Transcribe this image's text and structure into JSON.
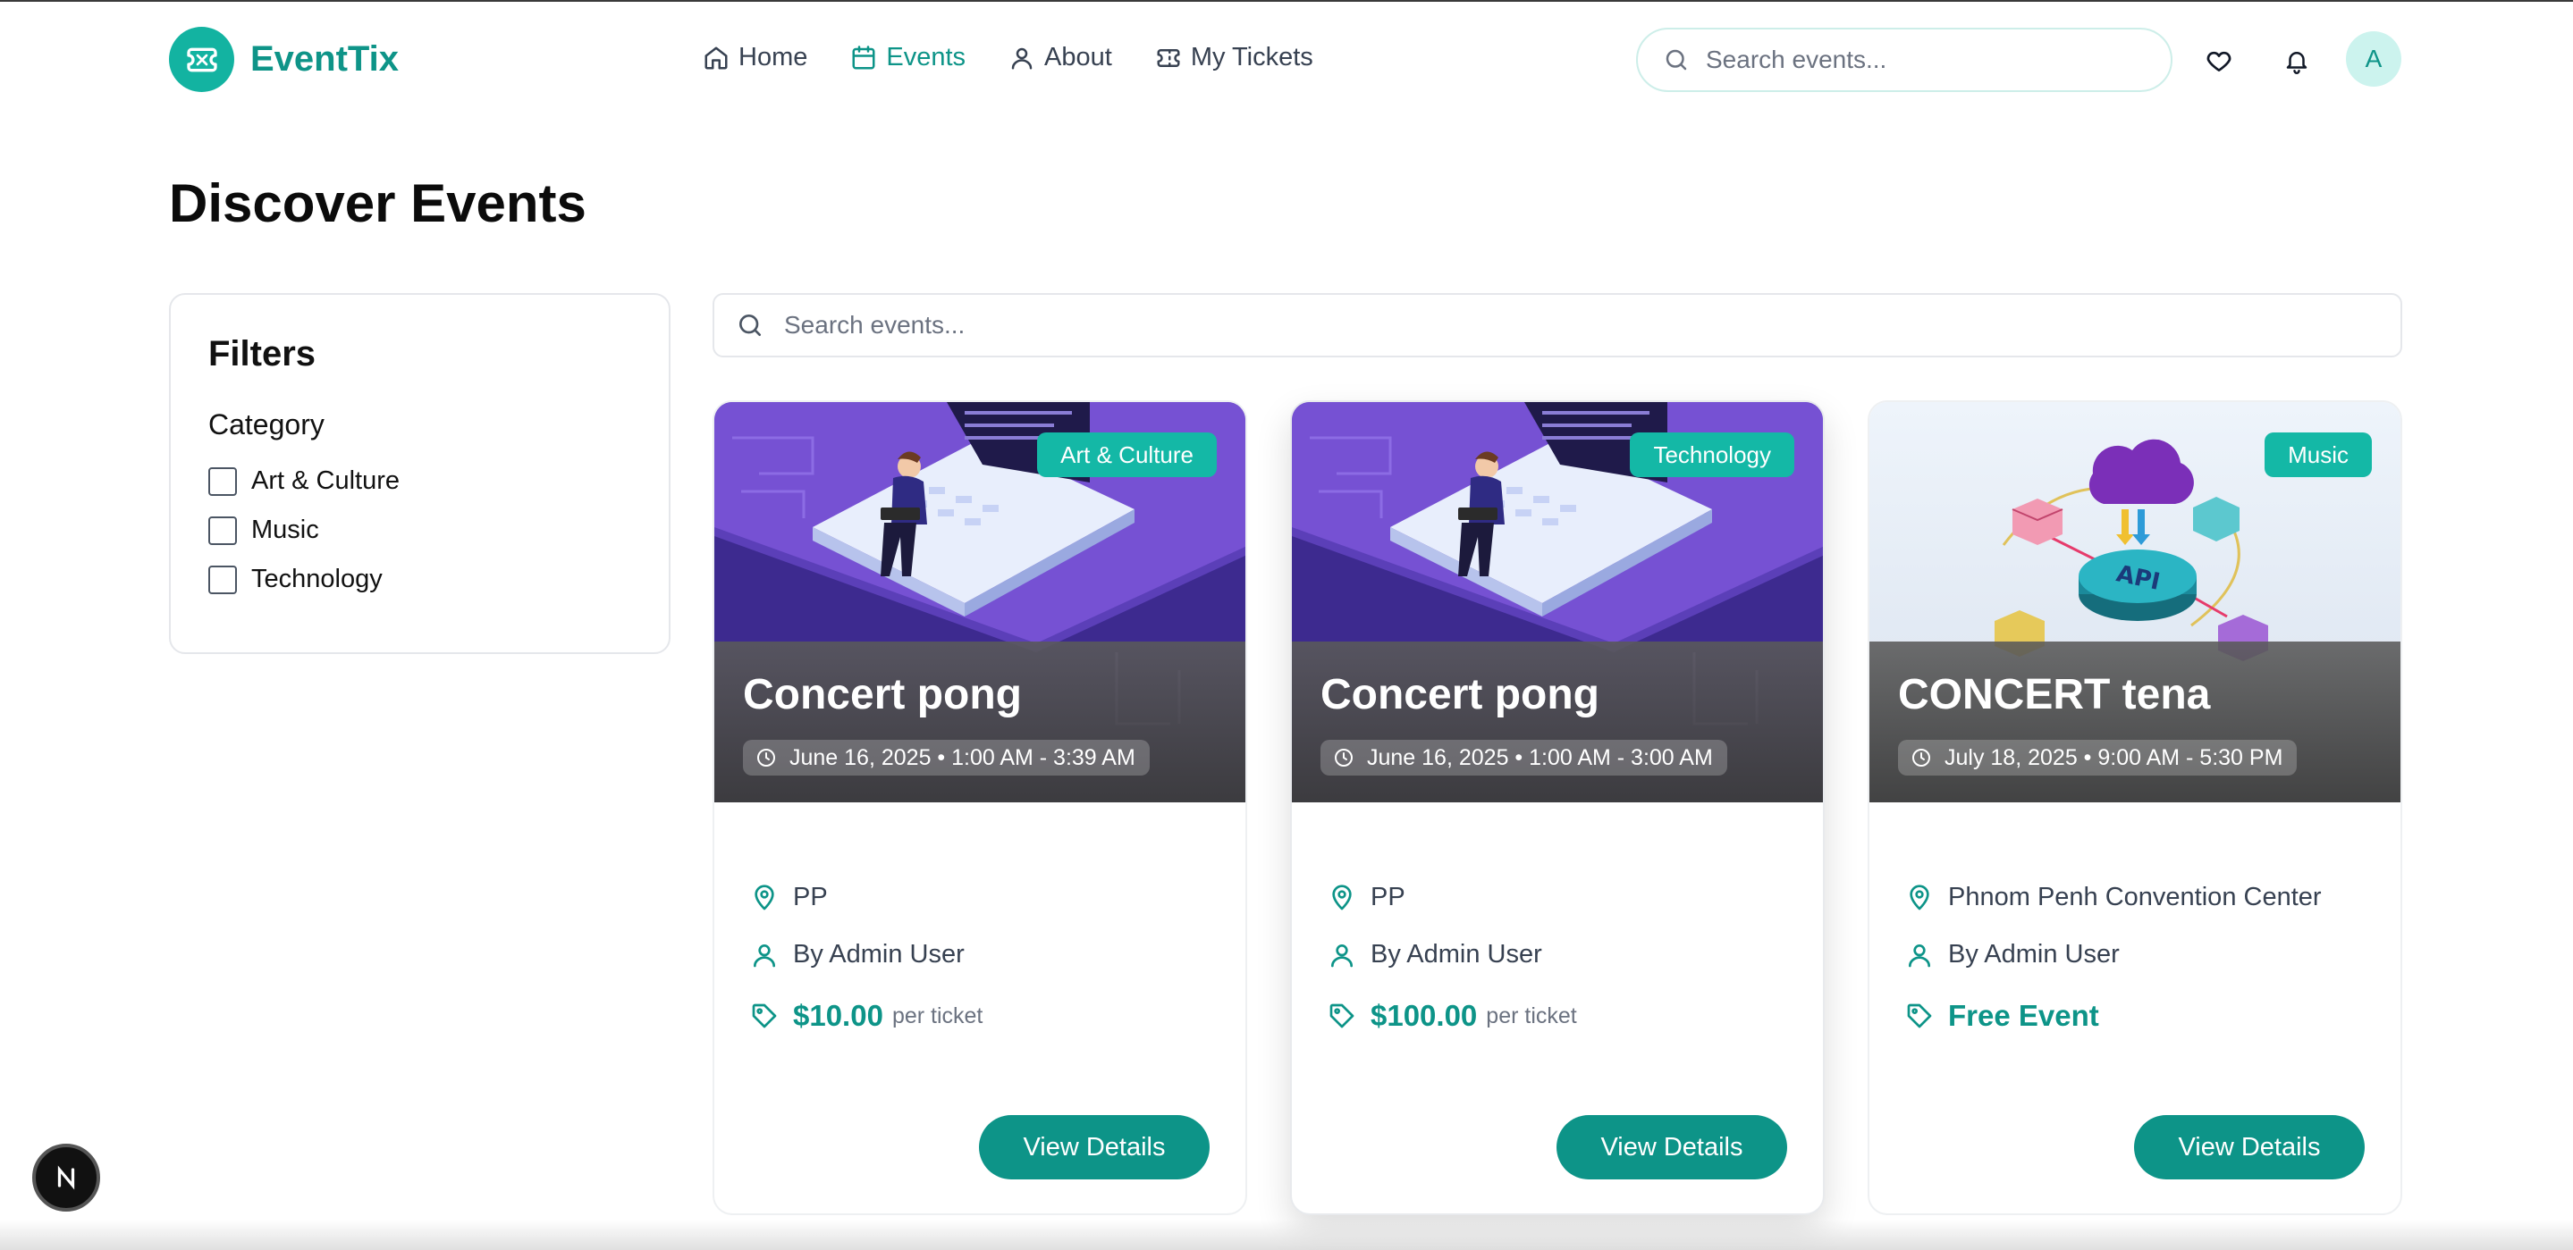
{
  "brand": {
    "name": "EventTix",
    "accent": "#0d9488"
  },
  "nav": {
    "items": [
      {
        "label": "Home",
        "icon": "home-icon"
      },
      {
        "label": "Events",
        "icon": "calendar-icon",
        "active": true
      },
      {
        "label": "About",
        "icon": "user-icon"
      },
      {
        "label": "My Tickets",
        "icon": "ticket-icon"
      }
    ]
  },
  "header": {
    "search_placeholder": "Search events...",
    "avatar_initial": "A"
  },
  "page": {
    "title": "Discover Events"
  },
  "filters": {
    "title": "Filters",
    "category_label": "Category",
    "options": [
      "Art & Culture",
      "Music",
      "Technology"
    ]
  },
  "main_search": {
    "placeholder": "Search events..."
  },
  "events": [
    {
      "badge": "Art & Culture",
      "title": "Concert pong",
      "datetime": "June 16, 2025 • 1:00 AM - 3:39 AM",
      "location": "PP",
      "organizer": "By Admin User",
      "price": "$10.00",
      "price_suffix": "per ticket",
      "button": "View Details"
    },
    {
      "badge": "Technology",
      "title": "Concert pong",
      "datetime": "June 16, 2025 • 1:00 AM - 3:00 AM",
      "location": "PP",
      "organizer": "By Admin User",
      "price": "$100.00",
      "price_suffix": "per ticket",
      "button": "View Details"
    },
    {
      "badge": "Music",
      "title": "CONCERT tena",
      "datetime": "July 18, 2025 • 9:00 AM - 5:30 PM",
      "location": "Phnom Penh Convention Center",
      "organizer": "By Admin User",
      "price": "Free Event",
      "price_suffix": "",
      "button": "View Details"
    }
  ],
  "dev_badge": "N"
}
